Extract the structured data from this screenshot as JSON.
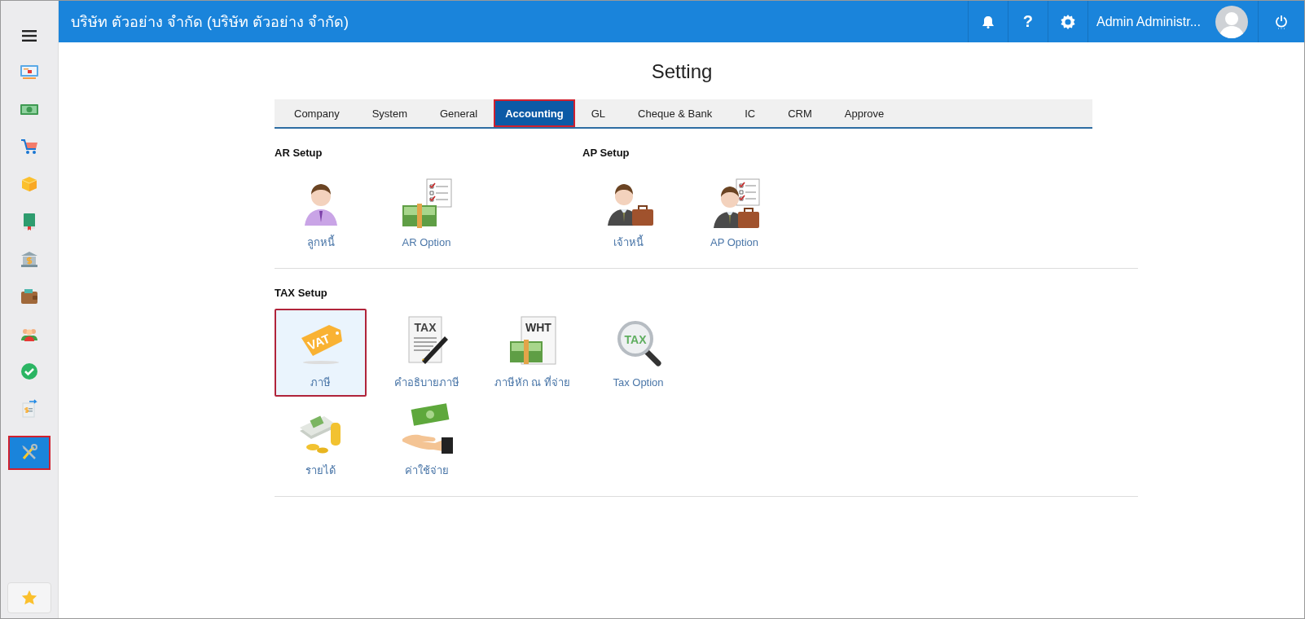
{
  "header": {
    "title": "บริษัท ตัวอย่าง จำกัด (บริษัท ตัวอย่าง จำกัด)",
    "help": "?",
    "user_name": "Admin Administr..."
  },
  "sidebar": {
    "items": [
      {
        "selected": false
      },
      {
        "selected": false
      },
      {
        "selected": false
      },
      {
        "selected": false
      },
      {
        "selected": false
      },
      {
        "selected": false
      },
      {
        "selected": false
      },
      {
        "selected": false
      },
      {
        "selected": false
      },
      {
        "selected": false
      },
      {
        "selected": true
      }
    ]
  },
  "page_title": "Setting",
  "tabs": [
    {
      "label": "Company",
      "selected": false
    },
    {
      "label": "System",
      "selected": false
    },
    {
      "label": "General",
      "selected": false
    },
    {
      "label": "Accounting",
      "selected": true
    },
    {
      "label": "GL",
      "selected": false
    },
    {
      "label": "Cheque & Bank",
      "selected": false
    },
    {
      "label": "IC",
      "selected": false
    },
    {
      "label": "CRM",
      "selected": false
    },
    {
      "label": "Approve",
      "selected": false
    }
  ],
  "sections": [
    {
      "groups": [
        {
          "title": "AR Setup",
          "items": [
            {
              "kind": "person",
              "label": "ลูกหนี้",
              "selected": false
            },
            {
              "kind": "money-checklist",
              "label": "AR Option",
              "selected": false
            }
          ]
        },
        {
          "title": "AP Setup",
          "items": [
            {
              "kind": "businessman",
              "label": "เจ้าหนี้",
              "selected": false
            },
            {
              "kind": "businessman-checklist",
              "label": "AP Option",
              "selected": false
            }
          ]
        }
      ]
    },
    {
      "groups": [
        {
          "title": "TAX Setup",
          "items": [
            {
              "kind": "tag",
              "icon_text": "VAT",
              "label": "ภาษี",
              "selected": true
            },
            {
              "kind": "document-pen",
              "icon_text": "TAX",
              "label": "คำอธิบายภาษี",
              "selected": false
            },
            {
              "kind": "document-money",
              "icon_text": "WHT",
              "label": "ภาษีหัก ณ ที่จ่าย",
              "selected": false
            },
            {
              "kind": "magnifier",
              "icon_text": "TAX",
              "label": "Tax Option",
              "selected": false
            },
            {
              "kind": "money-coins",
              "label": "รายได้",
              "selected": false
            },
            {
              "kind": "hand-money",
              "label": "ค่าใช้จ่าย",
              "selected": false
            }
          ]
        }
      ]
    }
  ]
}
